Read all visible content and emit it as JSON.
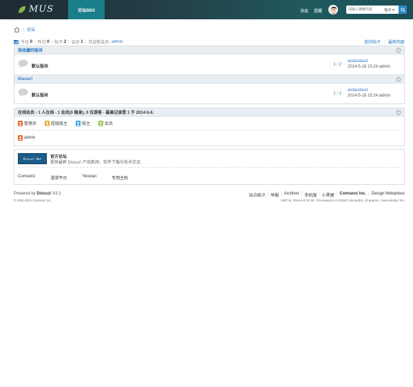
{
  "header": {
    "logo_text": "MUS",
    "nav_bbs": "论坛BBS",
    "messages": "消息",
    "reminders": "提醒",
    "search_placeholder": "请输入搜索内容",
    "search_type": "帖子",
    "colors": {
      "accent": "#1a7f8a",
      "link": "#2b77c1"
    }
  },
  "breadcrumb": {
    "home_icon": "home-icon",
    "current": "论坛"
  },
  "stats": {
    "today_label": "今日:",
    "today": "0",
    "yesterday_label": "昨日:",
    "yesterday": "0",
    "posts_label": "帖子:",
    "posts": "2",
    "members_label": "会员:",
    "members": "1",
    "welcome_label": "欢迎新会员:",
    "new_member": "admin",
    "my_posts": "我的帖子",
    "latest_replies": "最新回复"
  },
  "categories": [
    {
      "title": "我收藏的版块",
      "forum": {
        "name": "默认版块",
        "threads": "1",
        "posts": "2",
        "last_title": "asdasdasd",
        "last_meta": "2014-5-18 15:24 admin"
      }
    },
    {
      "title": "Discuz!",
      "forum": {
        "name": "默认版块",
        "threads": "1",
        "posts": "2",
        "last_title": "asdasdasd",
        "last_meta": "2014-5-18 15:24 admin"
      }
    }
  ],
  "online": {
    "title": "在线会员 - 1 人在线 - 1 会员(0 隐身), 0 位游客 - 最高记录是 1 于 2014-5-6.",
    "legend": [
      "管理员",
      "超级版主",
      "版主",
      "会员"
    ],
    "users": [
      "admin"
    ]
  },
  "links": {
    "partner_logo": "Discuz! Net",
    "partner_name": "官方论坛",
    "partner_desc": "提供最新 Discuz! 产品新闻、软件下载与技术交流",
    "text_links": [
      "Comsenz",
      "漫游平台",
      "Yeswan",
      "专用主机"
    ]
  },
  "footer": {
    "powered": "Powered by",
    "brand": "Discuz!",
    "version": "X3.1",
    "copyright": "© 2001-2013 Comsenz Inc.",
    "links": [
      "站点统计",
      "举报",
      "Archiver",
      "手机版",
      "小黑屋"
    ],
    "company": "Comsenz Inc.",
    "design": "Design Mobanbus",
    "gmt": "GMT+8, 2014-6-9 21:30 , Processed in 0.315047 second(s), 10 queries , Eaccelerator On."
  }
}
